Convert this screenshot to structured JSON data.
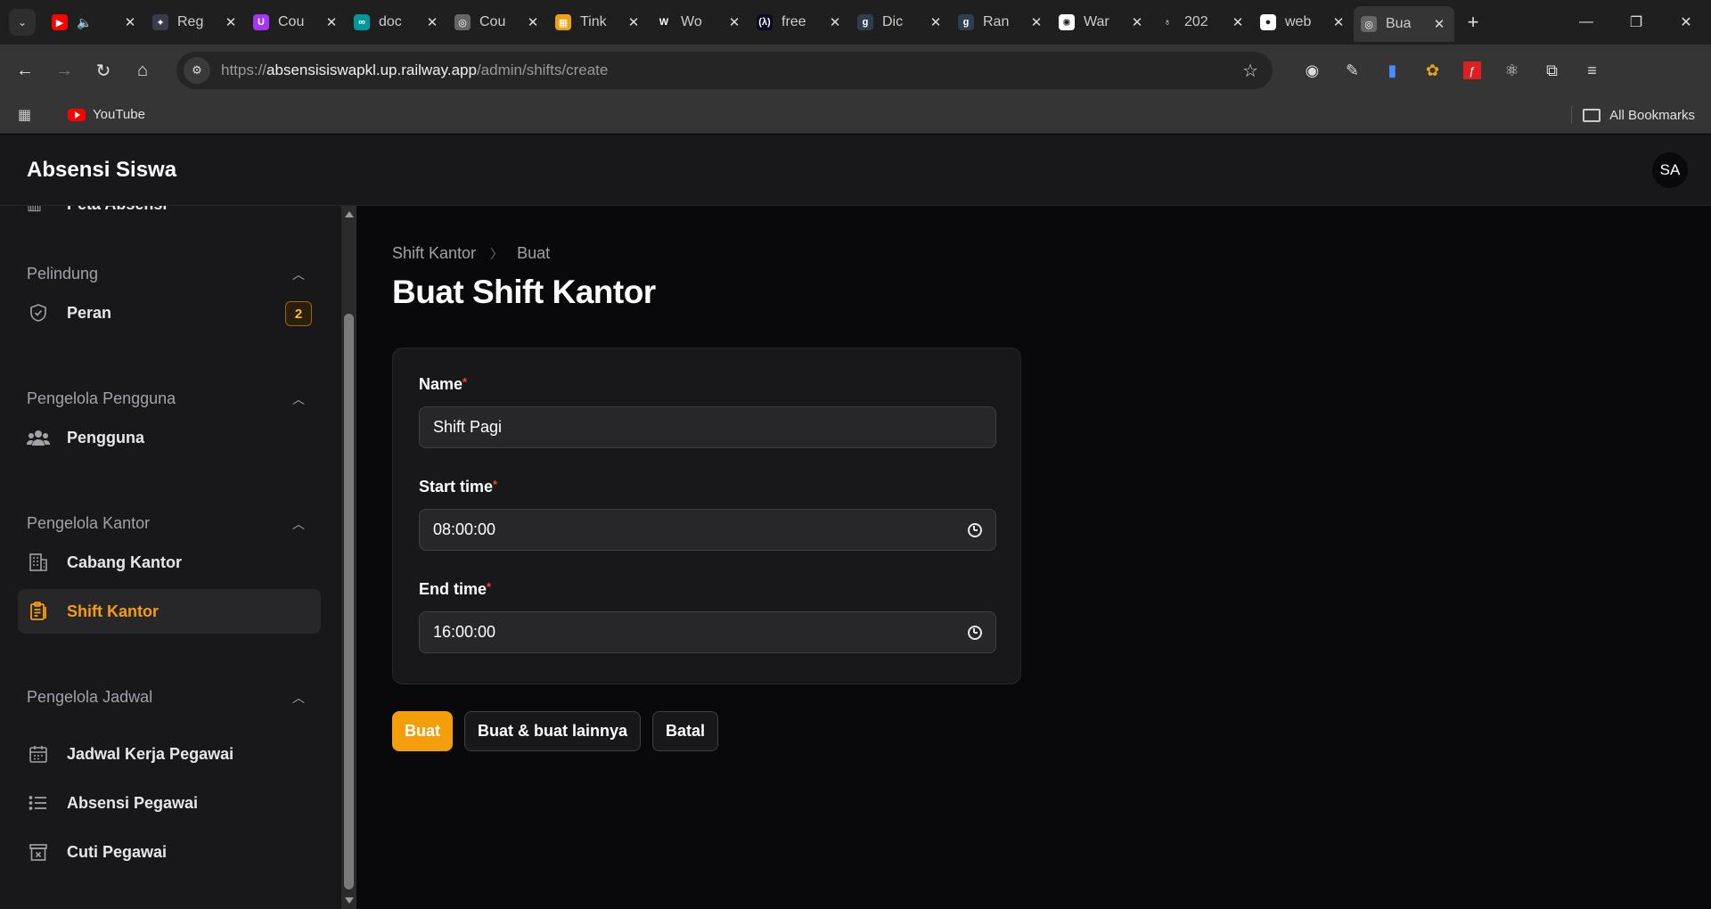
{
  "browser": {
    "tabs": [
      {
        "title": "",
        "favicon": "youtube-icon",
        "color": "#ff0000",
        "glyph": "▶"
      },
      {
        "title": "Reg",
        "favicon": "dashboard-icon",
        "color": "#3b3b4f",
        "glyph": "✦"
      },
      {
        "title": "Cou",
        "favicon": "udemy-icon",
        "color": "#a435f0",
        "glyph": "U"
      },
      {
        "title": "doc",
        "favicon": "arduino-icon",
        "color": "#00979d",
        "glyph": "∞"
      },
      {
        "title": "Cou",
        "favicon": "globe-icon",
        "color": "#666666",
        "glyph": "◎"
      },
      {
        "title": "Tink",
        "favicon": "tinkercad-icon",
        "color": "#e8a317",
        "glyph": "▦"
      },
      {
        "title": "Wo",
        "favicon": "wikipedia-icon",
        "color": "#1f1f1f",
        "glyph": "W"
      },
      {
        "title": "free",
        "favicon": "freecodecamp-icon",
        "color": "#0a0a23",
        "glyph": "(λ)"
      },
      {
        "title": "Dic",
        "favicon": "dicoding-icon",
        "color": "#2d3e50",
        "glyph": "g"
      },
      {
        "title": "Ran",
        "favicon": "dicoding-icon",
        "color": "#2d3e50",
        "glyph": "g"
      },
      {
        "title": "War",
        "favicon": "openai-icon",
        "color": "#ffffff",
        "glyph": "✺"
      },
      {
        "title": "202",
        "favicon": "pin-icon",
        "color": "#1f1f1f",
        "glyph": "♁"
      },
      {
        "title": "web",
        "favicon": "globe-icon",
        "color": "#ffffff",
        "glyph": "●"
      },
      {
        "title": "Bua",
        "favicon": "globe-icon",
        "color": "#666666",
        "glyph": "◎"
      }
    ],
    "url_scheme": "https://",
    "url_host": "absensisiswapkl.up.railway.app",
    "url_path": "/admin/shifts/create",
    "bookmark_youtube": "YouTube",
    "all_bookmarks": "All Bookmarks"
  },
  "app": {
    "brand": "Absensi Siswa",
    "avatar_initials": "SA"
  },
  "sidebar": {
    "cut_item": "Peta Absensi",
    "groups": [
      {
        "label": "Pelindung",
        "items": [
          {
            "label": "Peran",
            "icon": "shield-check-icon",
            "badge": "2"
          }
        ]
      },
      {
        "label": "Pengelola Pengguna",
        "items": [
          {
            "label": "Pengguna",
            "icon": "users-icon"
          }
        ]
      },
      {
        "label": "Pengelola Kantor",
        "items": [
          {
            "label": "Cabang Kantor",
            "icon": "building-icon"
          },
          {
            "label": "Shift Kantor",
            "icon": "clipboard-icon",
            "active": true
          }
        ]
      },
      {
        "label": "Pengelola Jadwal",
        "items": [
          {
            "label": "Jadwal Kerja Pegawai",
            "icon": "calendar-icon"
          },
          {
            "label": "Absensi Pegawai",
            "icon": "list-icon"
          },
          {
            "label": "Cuti Pegawai",
            "icon": "archive-icon"
          }
        ]
      }
    ]
  },
  "main": {
    "breadcrumb": [
      "Shift Kantor",
      "Buat"
    ],
    "title": "Buat Shift Kantor",
    "form": {
      "name_label": "Name",
      "name_value": "Shift Pagi",
      "start_label": "Start time",
      "start_value": "08:00:00",
      "end_label": "End time",
      "end_value": "16:00:00",
      "required_mark": "*"
    },
    "actions": {
      "create": "Buat",
      "create_another": "Buat & buat lainnya",
      "cancel": "Batal"
    }
  },
  "colors": {
    "accent": "#f59e0b",
    "required": "#ef4444"
  }
}
